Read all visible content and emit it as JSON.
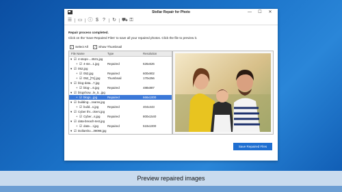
{
  "window": {
    "title": "Stellar Repair for Photo",
    "min": "—",
    "max": "☐",
    "close": "✕"
  },
  "messages": {
    "completed": "Repair process completed.",
    "instruction": "Click on the 'Save Repaired Files' to save all your repaired photos. Click the file to preview it."
  },
  "options": {
    "select_all": "Select All",
    "show_thumbnail": "Show Thumbnail"
  },
  "table": {
    "headers": [
      "File Name",
      "Type",
      "Resolution"
    ],
    "rows": [
      {
        "name": "4-steps-...4531.jpg",
        "type": "",
        "res": "",
        "level": 0,
        "kind": "folder"
      },
      {
        "name": "4-ste...1.jpg",
        "type": "Repaired",
        "res": "626x626",
        "level": 1,
        "kind": "file"
      },
      {
        "name": "052.jpg",
        "type": "",
        "res": "",
        "level": 0,
        "kind": "folder"
      },
      {
        "name": "052.jpg",
        "type": "Repaired",
        "res": "600x902",
        "level": 1,
        "kind": "file"
      },
      {
        "name": "052_[T1].jpg",
        "type": "Thumbnail",
        "res": "170x256",
        "level": 1,
        "kind": "file"
      },
      {
        "name": "blog-data...7.jpg",
        "type": "",
        "res": "",
        "level": 0,
        "kind": "folder"
      },
      {
        "name": "blog-...6.jpg",
        "type": "Repaired",
        "res": "488x887",
        "level": 1,
        "kind": "file"
      },
      {
        "name": "blogshow...le_5...jpg",
        "type": "",
        "res": "",
        "level": 0,
        "kind": "folder"
      },
      {
        "name": "blogs...jpg",
        "type": "Repaired",
        "res": "666x1000",
        "level": 1,
        "kind": "file",
        "selected": true
      },
      {
        "name": "building-...teams.jpg",
        "type": "",
        "res": "",
        "level": 0,
        "kind": "folder"
      },
      {
        "name": "build...s.jpg",
        "type": "Repaired",
        "res": "404x443",
        "level": 1,
        "kind": "file"
      },
      {
        "name": "Cyber thr...ckers.jpg",
        "type": "",
        "res": "",
        "level": 0,
        "kind": "folder"
      },
      {
        "name": "Cyber...s.jpg",
        "type": "Repaired",
        "res": "800x1540",
        "level": 1,
        "kind": "file"
      },
      {
        "name": "data-breach-test.jpg",
        "type": "",
        "res": "",
        "level": 0,
        "kind": "folder"
      },
      {
        "name": "data-...t.jpg",
        "type": "Repaired",
        "res": "519x1000",
        "level": 1,
        "kind": "file"
      },
      {
        "name": "Dollarsho...39098.jpg",
        "type": "",
        "res": "",
        "level": 0,
        "kind": "folder"
      }
    ]
  },
  "buttons": {
    "save": "Save Repaired Files"
  },
  "caption": "Preview repaired images",
  "colors": {
    "accent": "#1f6fd1",
    "selection": "#3b78d8",
    "desktop": "#1b73c9"
  }
}
